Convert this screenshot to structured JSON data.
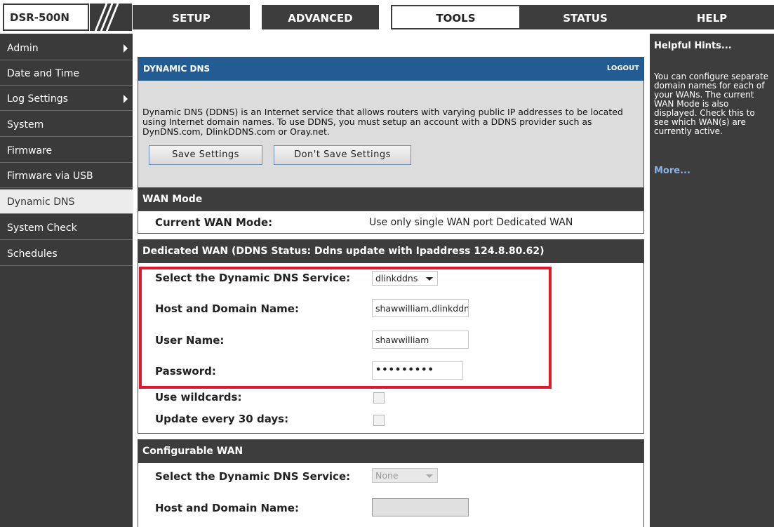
{
  "header": {
    "model": "DSR-500N",
    "tabs": [
      {
        "label": "SETUP"
      },
      {
        "label": "ADVANCED"
      },
      {
        "label": "TOOLS",
        "active": true
      },
      {
        "label": "STATUS"
      },
      {
        "label": "HELP"
      }
    ]
  },
  "sidebar": {
    "items": [
      {
        "label": "Admin",
        "has_submenu": true
      },
      {
        "label": "Date and Time"
      },
      {
        "label": "Log Settings",
        "has_submenu": true
      },
      {
        "label": "System"
      },
      {
        "label": "Firmware"
      },
      {
        "label": "Firmware via USB"
      },
      {
        "label": "Dynamic DNS",
        "active": true
      },
      {
        "label": "System Check"
      },
      {
        "label": "Schedules"
      }
    ]
  },
  "intro": {
    "title": "DYNAMIC DNS",
    "logout": "LOGOUT",
    "description": "Dynamic DNS (DDNS) is an Internet service that allows routers with varying public IP addresses to be located using Internet domain names. To use DDNS, you must setup an account with a DDNS provider such as DynDNS.com, DlinkDDNS.com or Oray.net.",
    "save_button": "Save Settings",
    "dont_save_button": "Don't Save Settings"
  },
  "wan_mode": {
    "title": "WAN Mode",
    "label": "Current WAN Mode:",
    "value": "Use only single WAN port Dedicated WAN"
  },
  "dedicated_wan": {
    "title": "Dedicated WAN (DDNS Status: Ddns update with Ipaddress 124.8.80.62)",
    "service_label": "Select the Dynamic DNS Service:",
    "service_value": "dlinkddns",
    "host_label": "Host and Domain Name:",
    "host_value": "shawwilliam.dlinkddns.com",
    "user_label": "User Name:",
    "user_value": "shawwilliam",
    "password_label": "Password:",
    "password_value": "•••••••••",
    "wildcards_label": "Use wildcards:",
    "update_label": "Update every 30 days:"
  },
  "configurable_wan": {
    "title": "Configurable WAN",
    "service_label": "Select the Dynamic DNS Service:",
    "service_value": "None",
    "host_label": "Host and Domain Name:"
  },
  "help": {
    "title": "Helpful Hints...",
    "body": "You can configure separate domain names for each of your WANs. The current WAN Mode is also displayed. Check this to see which WAN(s) are currently active.",
    "more": "More..."
  },
  "colors": {
    "dark": "#3d3d3d",
    "intro_header": "#235b93",
    "highlight": "#e0192a",
    "link": "#8ab4e8"
  }
}
